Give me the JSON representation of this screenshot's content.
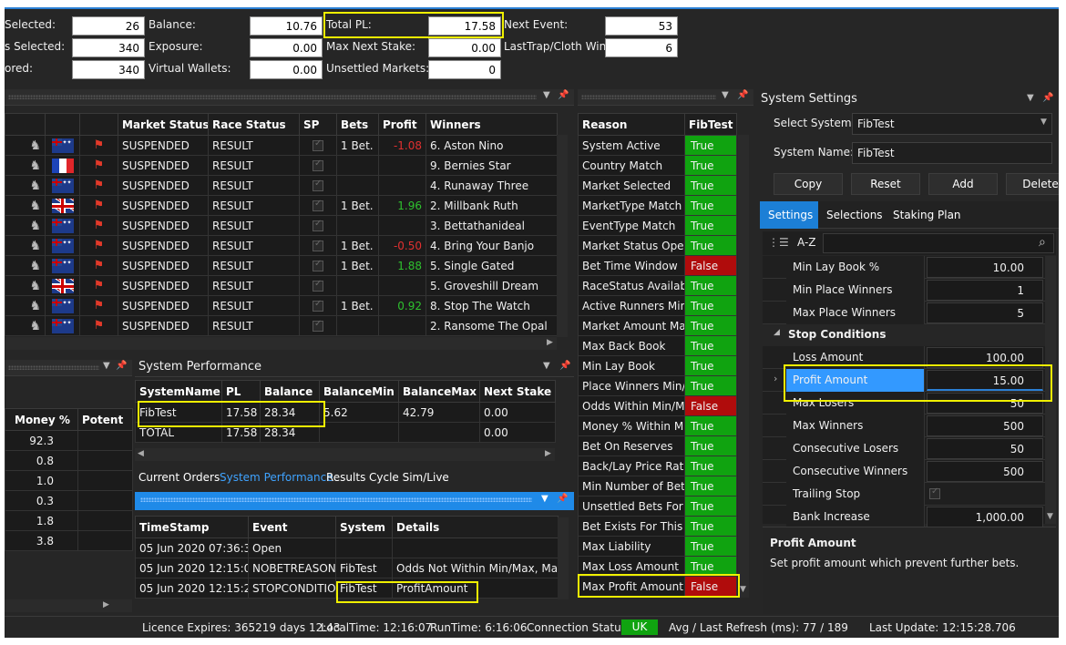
{
  "stats": {
    "selected_label": "Selected:",
    "selected_value": "26",
    "markets_selected_label": "s Selected:",
    "markets_selected_value": "340",
    "ored_label": "ored:",
    "ored_value": "340",
    "balance_label": "Balance:",
    "balance_value": "10.76",
    "exposure_label": "Exposure:",
    "exposure_value": "0.00",
    "virtual_wallets_label": "Virtual Wallets:",
    "virtual_wallets_value": "0.00",
    "total_pl_label": "Total PL:",
    "total_pl_value": "17.58",
    "max_next_stake_label": "Max Next Stake:",
    "max_next_stake_value": "0.00",
    "unsettled_markets_label": "Unsettled Markets:",
    "unsettled_markets_value": "0",
    "next_event_label": "Next Event:",
    "next_event_value": "53",
    "last_trap_label": "LastTrap/Cloth Win:",
    "last_trap_value": "6"
  },
  "markets": {
    "headers": [
      "Market Status",
      "Race Status",
      "SP",
      "Bets",
      "Profit",
      "Winners"
    ],
    "rows": [
      {
        "flag": "AU",
        "market_status": "SUSPENDED",
        "race_status": "RESULT",
        "bets": "1 Bet.",
        "profit": "-1.08",
        "profit_sign": "neg",
        "winner": "6. Aston Nino"
      },
      {
        "flag": "FR",
        "market_status": "SUSPENDED",
        "race_status": "RESULT",
        "bets": "",
        "profit": "",
        "profit_sign": "",
        "winner": "9. Bernies Star"
      },
      {
        "flag": "AU",
        "market_status": "SUSPENDED",
        "race_status": "RESULT",
        "bets": "",
        "profit": "",
        "profit_sign": "",
        "winner": "4. Runaway Three"
      },
      {
        "flag": "UK",
        "market_status": "SUSPENDED",
        "race_status": "RESULT",
        "bets": "1 Bet.",
        "profit": "1.96",
        "profit_sign": "pos",
        "winner": "2. Millbank Ruth"
      },
      {
        "flag": "AU",
        "market_status": "SUSPENDED",
        "race_status": "RESULT",
        "bets": "",
        "profit": "",
        "profit_sign": "",
        "winner": "3. Bettathanideal"
      },
      {
        "flag": "AU",
        "market_status": "SUSPENDED",
        "race_status": "RESULT",
        "bets": "1 Bet.",
        "profit": "-0.50",
        "profit_sign": "neg",
        "winner": "4. Bring Your Banjo"
      },
      {
        "flag": "AU",
        "market_status": "SUSPENDED",
        "race_status": "RESULT",
        "bets": "1 Bet.",
        "profit": "1.88",
        "profit_sign": "pos",
        "winner": "5. Single Gated"
      },
      {
        "flag": "UK",
        "market_status": "SUSPENDED",
        "race_status": "RESULT",
        "bets": "",
        "profit": "",
        "profit_sign": "",
        "winner": "5. Groveshill Dream"
      },
      {
        "flag": "AU",
        "market_status": "SUSPENDED",
        "race_status": "RESULT",
        "bets": "1 Bet.",
        "profit": "0.92",
        "profit_sign": "pos",
        "winner": "8. Stop The Watch"
      },
      {
        "flag": "AU",
        "market_status": "SUSPENDED",
        "race_status": "RESULT",
        "bets": "",
        "profit": "",
        "profit_sign": "",
        "winner": "2. Ransome The Opal"
      }
    ]
  },
  "reasons": {
    "headers": [
      "Reason",
      "FibTest"
    ],
    "rows": [
      {
        "reason": "System Active",
        "value": "True"
      },
      {
        "reason": "Country Match",
        "value": "True"
      },
      {
        "reason": "Market Selected",
        "value": "True"
      },
      {
        "reason": "MarketType Match",
        "value": "True"
      },
      {
        "reason": "EventType Match",
        "value": "True"
      },
      {
        "reason": "Market Status Open",
        "value": "True"
      },
      {
        "reason": "Bet Time Window",
        "value": "False"
      },
      {
        "reason": "RaceStatus Available",
        "value": "True"
      },
      {
        "reason": "Active Runners Min/M",
        "value": "True"
      },
      {
        "reason": "Market Amount Matc",
        "value": "True"
      },
      {
        "reason": "Max Back Book",
        "value": "True"
      },
      {
        "reason": "Min Lay Book",
        "value": "True"
      },
      {
        "reason": "Place Winners Min/M",
        "value": "True"
      },
      {
        "reason": "Odds Within Min/Ma",
        "value": "False"
      },
      {
        "reason": "Money % Within Min",
        "value": "True"
      },
      {
        "reason": "Bet On Reserves",
        "value": "True"
      },
      {
        "reason": "Back/Lay Price Ratio",
        "value": "True"
      },
      {
        "reason": "Min Number of Bets",
        "value": "True"
      },
      {
        "reason": "Unsettled Bets For Sy",
        "value": "True"
      },
      {
        "reason": "Bet Exists For This Ma",
        "value": "True"
      },
      {
        "reason": "Max Liability",
        "value": "True"
      },
      {
        "reason": "Max Loss Amount",
        "value": "True"
      },
      {
        "reason": "Max Profit Amount",
        "value": "False"
      }
    ]
  },
  "money": {
    "headers": [
      "Money %",
      "Potent"
    ],
    "rows": [
      "92.3",
      "0.8",
      "1.0",
      "0.3",
      "1.8",
      "3.8"
    ]
  },
  "performance": {
    "title": "System Performance",
    "headers": [
      "SystemName",
      "PL",
      "Balance",
      "BalanceMin",
      "BalanceMax",
      "Next Stake"
    ],
    "rows": [
      {
        "name": "FibTest",
        "pl": "17.58",
        "balance": "28.34",
        "bmin": "5.62",
        "bmax": "42.79",
        "next": "0.00"
      },
      {
        "name": "TOTAL",
        "pl": "17.58",
        "balance": "28.34",
        "bmin": "",
        "bmax": "",
        "next": "0.00"
      }
    ],
    "tabs": [
      "Current Orders",
      "System Performance",
      "Results",
      "Cycle Sim/Live"
    ]
  },
  "log": {
    "headers": [
      "TimeStamp",
      "Event",
      "System",
      "Details"
    ],
    "rows": [
      {
        "ts": "05 Jun 2020 07:36:37",
        "event": "Open",
        "system": "",
        "details": ""
      },
      {
        "ts": "05 Jun 2020 12:15:00",
        "event": "NOBETREASONS",
        "system": "FibTest",
        "details": "Odds Not Within Min/Max, Max"
      },
      {
        "ts": "05 Jun 2020 12:15:28",
        "event": "STOPCONDITION",
        "system": "FibTest",
        "details": "ProfitAmount"
      }
    ]
  },
  "settings": {
    "title": "System Settings",
    "select_system_label": "Select System:",
    "select_system_value": "FibTest",
    "system_name_label": "System Name:",
    "system_name_value": "FibTest",
    "buttons": [
      "Copy",
      "Reset",
      "Add",
      "Delete"
    ],
    "tabs": [
      "Settings",
      "Selections",
      "Staking Plan"
    ],
    "sort_label": "A-Z",
    "props_top": [
      {
        "name": "Min Lay Book %",
        "value": "10.00"
      },
      {
        "name": "Min Place Winners",
        "value": "1"
      },
      {
        "name": "Max Place Winners",
        "value": "5"
      }
    ],
    "section": "Stop Conditions",
    "props_stop": [
      {
        "name": "Loss Amount",
        "value": "100.00"
      },
      {
        "name": "Profit Amount",
        "value": "15.00"
      },
      {
        "name": "Max Losers",
        "value": "50"
      },
      {
        "name": "Max Winners",
        "value": "500"
      },
      {
        "name": "Consecutive Losers",
        "value": "50"
      },
      {
        "name": "Consecutive Winners",
        "value": "500"
      },
      {
        "name": "Trailing Stop",
        "value": ""
      },
      {
        "name": "Bank Increase",
        "value": "1,000.00"
      }
    ],
    "desc_title": "Profit Amount",
    "desc_text": "Set profit amount which prevent further bets."
  },
  "status": {
    "licence": "Licence Expires: 365219 days 12:43",
    "local_time": "LocalTime: 12:16:07",
    "run_time": "RunTime: 6:16:06",
    "connection_label": "Connection Status:",
    "connection_value": "UK",
    "refresh": "Avg / Last Refresh (ms): 77 / 189",
    "last_update": "Last Update: 12:15:28.706"
  },
  "colors": {
    "accent": "#2a7fd4",
    "true_bg": "#10a310",
    "false_bg": "#b00c0c",
    "highlight": "#f0f000",
    "selected_row": "#3399ff"
  }
}
